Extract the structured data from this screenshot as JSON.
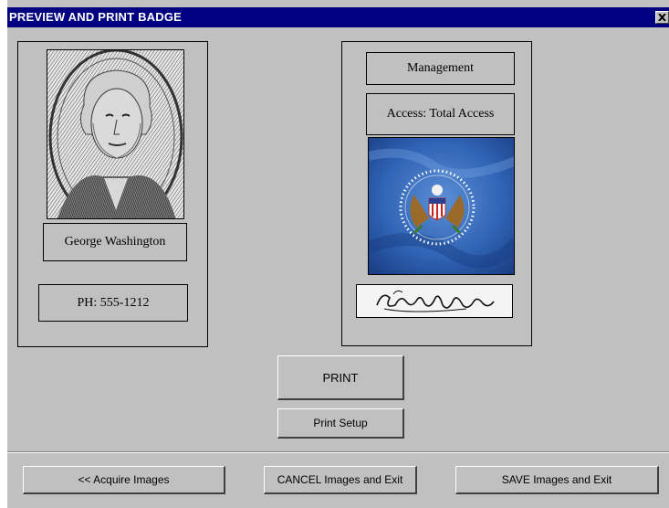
{
  "window": {
    "title": "PREVIEW AND PRINT BADGE"
  },
  "icons": {
    "close": "close-icon",
    "portrait": "portrait-photo",
    "seal": "presidential-seal-image",
    "signature": "signature-image"
  },
  "badge_front": {
    "name": "George Washington",
    "phone": "PH: 555-1212"
  },
  "badge_back": {
    "department": "Management",
    "access": "Access: Total Access"
  },
  "buttons": {
    "print": "PRINT",
    "print_setup": "Print Setup",
    "acquire": "<< Acquire Images",
    "cancel": "CANCEL Images and Exit",
    "save": "SAVE Images and Exit"
  },
  "colors": {
    "titlebar": "#000080",
    "face": "#c0c0c0",
    "seal_bg": "#2f63b4"
  }
}
